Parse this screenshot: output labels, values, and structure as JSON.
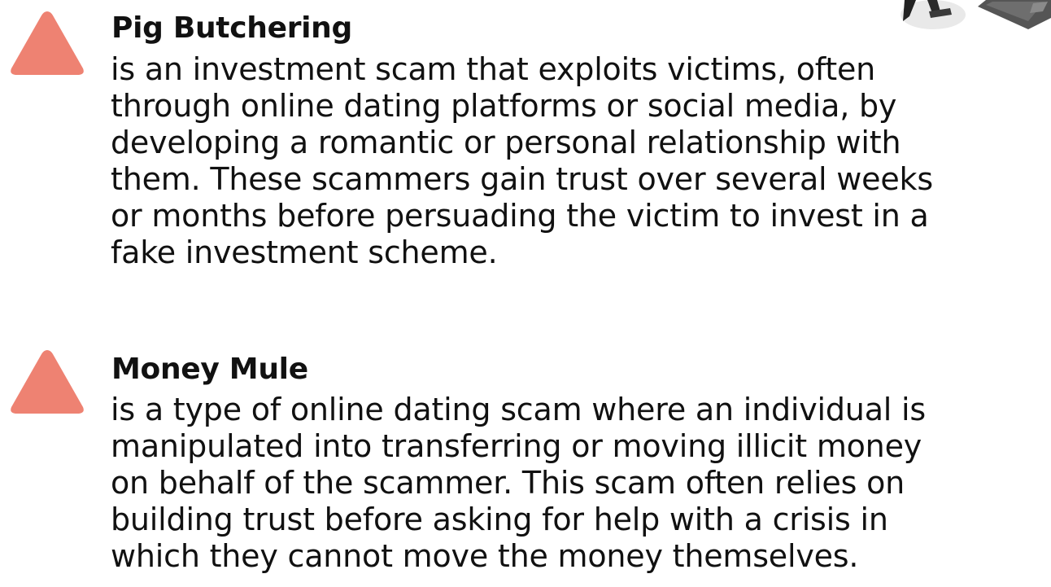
{
  "accent_color": "#ee8272",
  "entries": [
    {
      "icon": "warning-triangle-icon",
      "title": "Pig Butchering",
      "lines": [
        "is an investment scam that exploits victims, often",
        "through online dating platforms or social media, by",
        "developing a romantic or personal relationship with",
        "them. These scammers gain trust over several weeks",
        "or months before persuading the victim to invest in a",
        "fake investment scheme."
      ]
    },
    {
      "icon": "warning-triangle-icon",
      "title": "Money Mule",
      "lines": [
        "is a type of online dating scam where an individual is",
        "manipulated into transferring or moving illicit money",
        "on behalf of the scammer. This scam often relies on",
        "building trust before asking for help with a crisis in",
        "which they cannot move the money themselves."
      ]
    }
  ]
}
